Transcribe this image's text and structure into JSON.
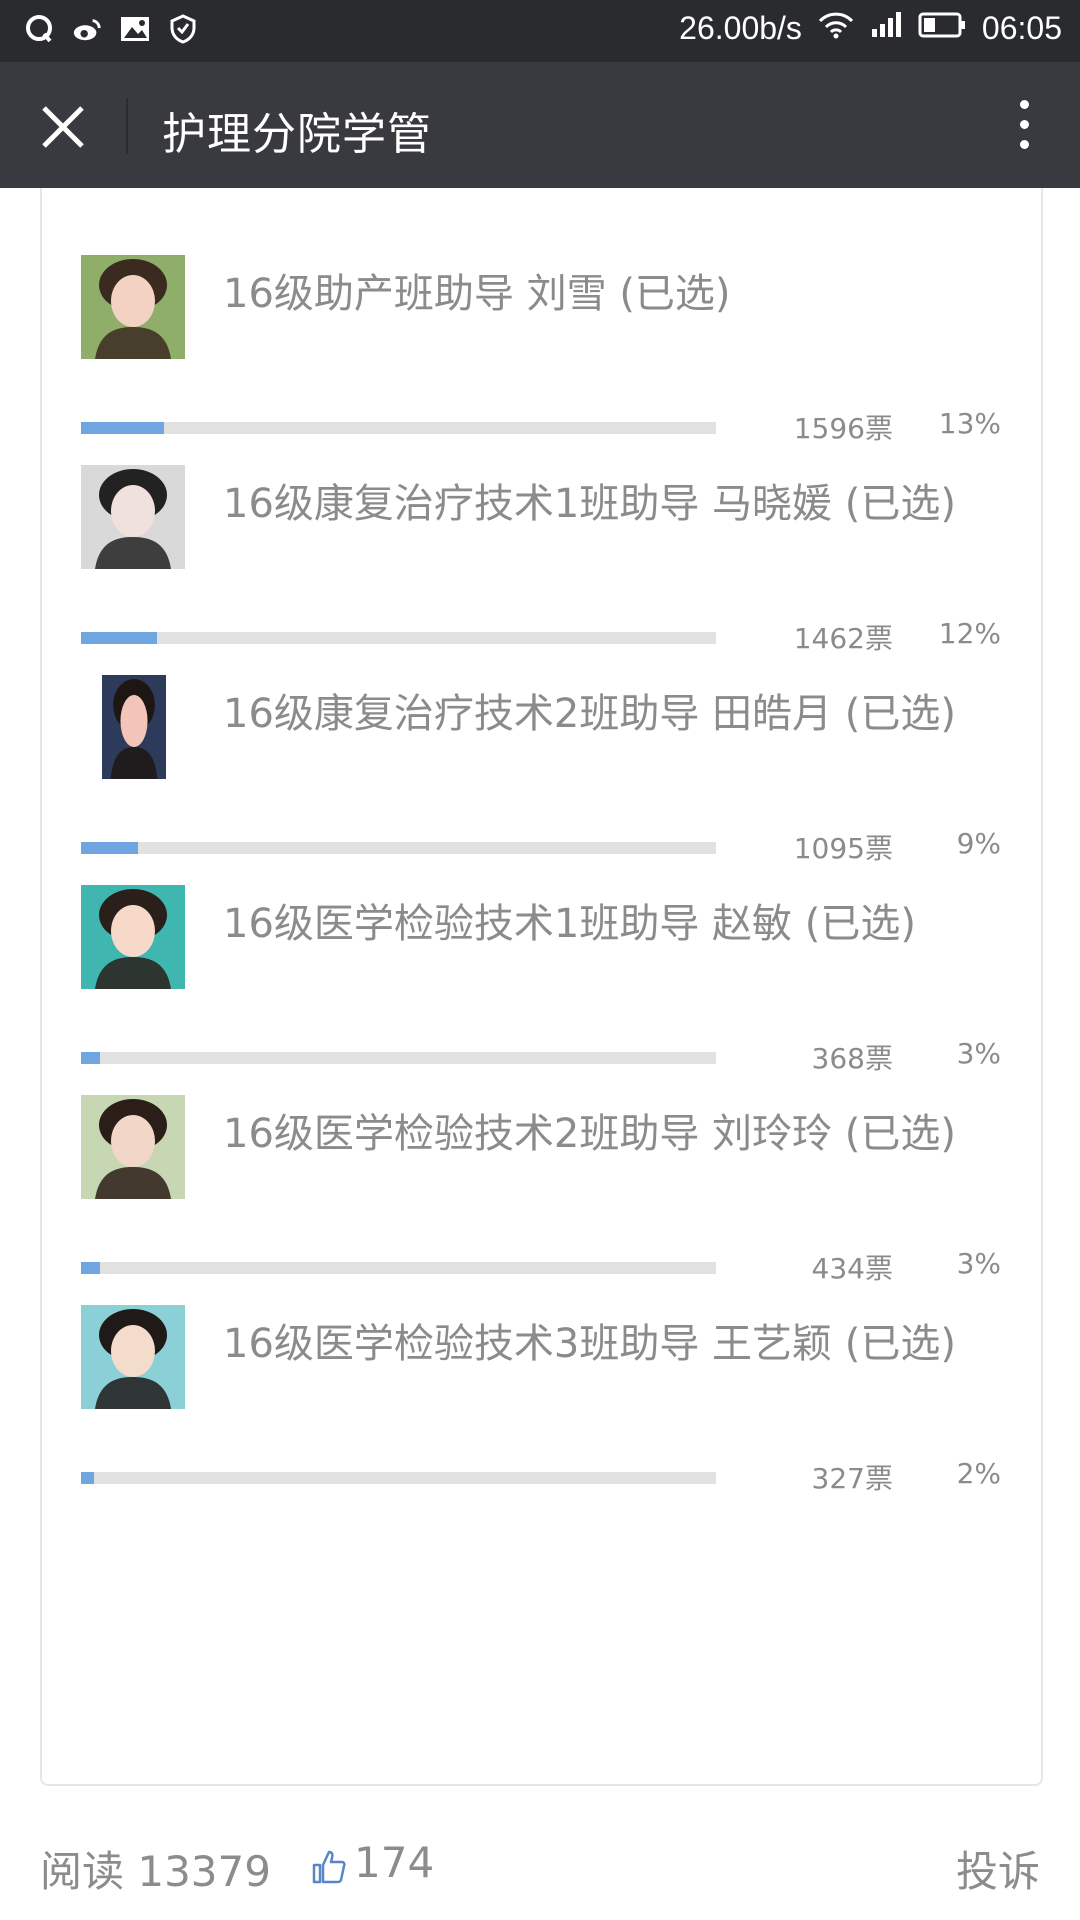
{
  "status_bar": {
    "speed": "26.00b/s",
    "time": "06:05",
    "icons": [
      "qq-icon",
      "weibo-icon",
      "gallery-icon",
      "shield-icon",
      "wifi-icon",
      "signal-icon",
      "battery-icon"
    ]
  },
  "header": {
    "title": "护理分院学管",
    "close_icon": "close-icon",
    "more_icon": "more-vertical-icon"
  },
  "options": [
    {
      "label": "16级助产班助导 刘雪 (已选)",
      "votes": "1596票",
      "percent": "13%",
      "fill": 0.13
    },
    {
      "label": "16级康复治疗技术1班助导 马晓媛 (已选)",
      "votes": "1462票",
      "percent": "12%",
      "fill": 0.12
    },
    {
      "label": "16级康复治疗技术2班助导 田皓月 (已选)",
      "votes": "1095票",
      "percent": "9%",
      "fill": 0.09
    },
    {
      "label": "16级医学检验技术1班助导 赵敏 (已选)",
      "votes": "368票",
      "percent": "3%",
      "fill": 0.03
    },
    {
      "label": "16级医学检验技术2班助导 刘玲玲 (已选)",
      "votes": "434票",
      "percent": "3%",
      "fill": 0.03
    },
    {
      "label": "16级医学检验技术3班助导 王艺颖 (已选)",
      "votes": "327票",
      "percent": "2%",
      "fill": 0.02
    }
  ],
  "footer": {
    "read_label": "阅读 13379",
    "like_count": "174",
    "report_label": "投诉"
  },
  "colors": {
    "status_bar": "#2a2b2e",
    "title_bar": "#393a3f",
    "progress_fill": "#6fa6df",
    "progress_track": "#e1e1e1",
    "text_gray": "#8b8b8b"
  }
}
